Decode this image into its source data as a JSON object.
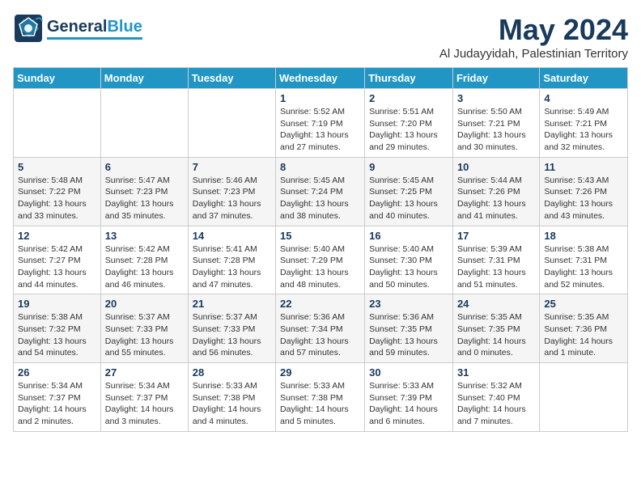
{
  "header": {
    "logo_general": "General",
    "logo_blue": "Blue",
    "month_year": "May 2024",
    "location": "Al Judayyidah, Palestinian Territory"
  },
  "weekdays": [
    "Sunday",
    "Monday",
    "Tuesday",
    "Wednesday",
    "Thursday",
    "Friday",
    "Saturday"
  ],
  "weeks": [
    [
      {
        "day": "",
        "info": ""
      },
      {
        "day": "",
        "info": ""
      },
      {
        "day": "",
        "info": ""
      },
      {
        "day": "1",
        "info": "Sunrise: 5:52 AM\nSunset: 7:19 PM\nDaylight: 13 hours\nand 27 minutes."
      },
      {
        "day": "2",
        "info": "Sunrise: 5:51 AM\nSunset: 7:20 PM\nDaylight: 13 hours\nand 29 minutes."
      },
      {
        "day": "3",
        "info": "Sunrise: 5:50 AM\nSunset: 7:21 PM\nDaylight: 13 hours\nand 30 minutes."
      },
      {
        "day": "4",
        "info": "Sunrise: 5:49 AM\nSunset: 7:21 PM\nDaylight: 13 hours\nand 32 minutes."
      }
    ],
    [
      {
        "day": "5",
        "info": "Sunrise: 5:48 AM\nSunset: 7:22 PM\nDaylight: 13 hours\nand 33 minutes."
      },
      {
        "day": "6",
        "info": "Sunrise: 5:47 AM\nSunset: 7:23 PM\nDaylight: 13 hours\nand 35 minutes."
      },
      {
        "day": "7",
        "info": "Sunrise: 5:46 AM\nSunset: 7:23 PM\nDaylight: 13 hours\nand 37 minutes."
      },
      {
        "day": "8",
        "info": "Sunrise: 5:45 AM\nSunset: 7:24 PM\nDaylight: 13 hours\nand 38 minutes."
      },
      {
        "day": "9",
        "info": "Sunrise: 5:45 AM\nSunset: 7:25 PM\nDaylight: 13 hours\nand 40 minutes."
      },
      {
        "day": "10",
        "info": "Sunrise: 5:44 AM\nSunset: 7:26 PM\nDaylight: 13 hours\nand 41 minutes."
      },
      {
        "day": "11",
        "info": "Sunrise: 5:43 AM\nSunset: 7:26 PM\nDaylight: 13 hours\nand 43 minutes."
      }
    ],
    [
      {
        "day": "12",
        "info": "Sunrise: 5:42 AM\nSunset: 7:27 PM\nDaylight: 13 hours\nand 44 minutes."
      },
      {
        "day": "13",
        "info": "Sunrise: 5:42 AM\nSunset: 7:28 PM\nDaylight: 13 hours\nand 46 minutes."
      },
      {
        "day": "14",
        "info": "Sunrise: 5:41 AM\nSunset: 7:28 PM\nDaylight: 13 hours\nand 47 minutes."
      },
      {
        "day": "15",
        "info": "Sunrise: 5:40 AM\nSunset: 7:29 PM\nDaylight: 13 hours\nand 48 minutes."
      },
      {
        "day": "16",
        "info": "Sunrise: 5:40 AM\nSunset: 7:30 PM\nDaylight: 13 hours\nand 50 minutes."
      },
      {
        "day": "17",
        "info": "Sunrise: 5:39 AM\nSunset: 7:31 PM\nDaylight: 13 hours\nand 51 minutes."
      },
      {
        "day": "18",
        "info": "Sunrise: 5:38 AM\nSunset: 7:31 PM\nDaylight: 13 hours\nand 52 minutes."
      }
    ],
    [
      {
        "day": "19",
        "info": "Sunrise: 5:38 AM\nSunset: 7:32 PM\nDaylight: 13 hours\nand 54 minutes."
      },
      {
        "day": "20",
        "info": "Sunrise: 5:37 AM\nSunset: 7:33 PM\nDaylight: 13 hours\nand 55 minutes."
      },
      {
        "day": "21",
        "info": "Sunrise: 5:37 AM\nSunset: 7:33 PM\nDaylight: 13 hours\nand 56 minutes."
      },
      {
        "day": "22",
        "info": "Sunrise: 5:36 AM\nSunset: 7:34 PM\nDaylight: 13 hours\nand 57 minutes."
      },
      {
        "day": "23",
        "info": "Sunrise: 5:36 AM\nSunset: 7:35 PM\nDaylight: 13 hours\nand 59 minutes."
      },
      {
        "day": "24",
        "info": "Sunrise: 5:35 AM\nSunset: 7:35 PM\nDaylight: 14 hours\nand 0 minutes."
      },
      {
        "day": "25",
        "info": "Sunrise: 5:35 AM\nSunset: 7:36 PM\nDaylight: 14 hours\nand 1 minute."
      }
    ],
    [
      {
        "day": "26",
        "info": "Sunrise: 5:34 AM\nSunset: 7:37 PM\nDaylight: 14 hours\nand 2 minutes."
      },
      {
        "day": "27",
        "info": "Sunrise: 5:34 AM\nSunset: 7:37 PM\nDaylight: 14 hours\nand 3 minutes."
      },
      {
        "day": "28",
        "info": "Sunrise: 5:33 AM\nSunset: 7:38 PM\nDaylight: 14 hours\nand 4 minutes."
      },
      {
        "day": "29",
        "info": "Sunrise: 5:33 AM\nSunset: 7:38 PM\nDaylight: 14 hours\nand 5 minutes."
      },
      {
        "day": "30",
        "info": "Sunrise: 5:33 AM\nSunset: 7:39 PM\nDaylight: 14 hours\nand 6 minutes."
      },
      {
        "day": "31",
        "info": "Sunrise: 5:32 AM\nSunset: 7:40 PM\nDaylight: 14 hours\nand 7 minutes."
      },
      {
        "day": "",
        "info": ""
      }
    ]
  ]
}
